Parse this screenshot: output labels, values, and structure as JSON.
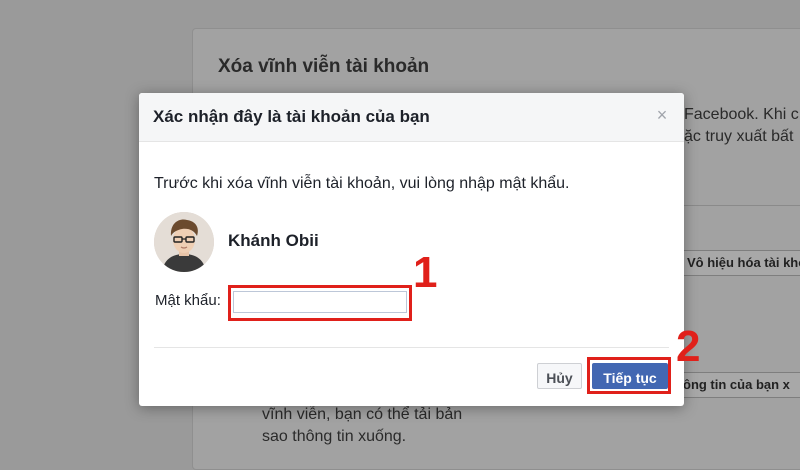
{
  "background": {
    "section_title": "Xóa vĩnh viễn tài khoản",
    "text_line_1": "Facebook. Khi c",
    "text_line_2": "ặc truy xuất bất",
    "deactivate_button": "Vô hiệu hóa tài khoản",
    "download_button": "ông tin của bạn x",
    "body_text": "vĩnh viễn, bạn có thể tải bản sao thông tin xuống."
  },
  "modal": {
    "title": "Xác nhận đây là tài khoản của bạn",
    "close_icon": "×",
    "description": "Trước khi xóa vĩnh viễn tài khoản, vui lòng nhập mật khẩu.",
    "user_name": "Khánh Obii",
    "password_label": "Mật khẩu:",
    "password_value": "",
    "cancel_label": "Hủy",
    "confirm_label": "Tiếp tục"
  },
  "annotations": {
    "step_1": "1",
    "step_2": "2"
  },
  "colors": {
    "accent": "#4267b2",
    "highlight": "#e0201a"
  },
  "icons": {
    "close": "close-icon",
    "avatar": "user-avatar"
  }
}
